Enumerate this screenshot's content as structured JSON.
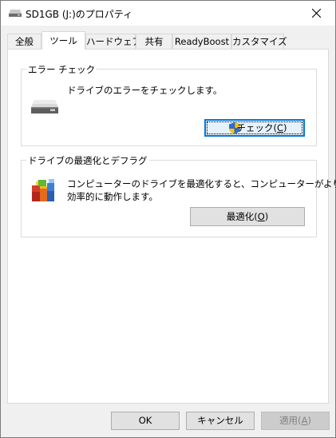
{
  "window": {
    "title": "SD1GB (J:)のプロパティ"
  },
  "tabs": [
    {
      "label": "全般",
      "active": false
    },
    {
      "label": "ツール",
      "active": true
    },
    {
      "label": "ハードウェア",
      "active": false
    },
    {
      "label": "共有",
      "active": false
    },
    {
      "label": "ReadyBoost",
      "active": false
    },
    {
      "label": "カスタマイズ",
      "active": false
    }
  ],
  "error_check": {
    "group_title": "エラー チェック",
    "description": "ドライブのエラーをチェックします。",
    "button_prefix": "チェック(",
    "button_accel": "C",
    "button_suffix": ")",
    "icon": "drive-icon",
    "button_icon": "uac-shield-icon"
  },
  "optimize": {
    "group_title": "ドライブの最適化とデフラグ",
    "description_line1": "コンピューターのドライブを最適化すると、コンピューターがより",
    "description_line2": "効率的に動作します。",
    "button_prefix": "最適化(",
    "button_accel": "O",
    "button_suffix": ")",
    "icon": "defrag-icon"
  },
  "footer": {
    "ok_label": "OK",
    "cancel_label": "キャンセル",
    "apply_prefix": "適用(",
    "apply_accel": "A",
    "apply_suffix": ")",
    "apply_enabled": false
  },
  "colors": {
    "focus_border": "#0078d7",
    "panel_background": "#ffffff",
    "window_background": "#f0f0f0"
  }
}
